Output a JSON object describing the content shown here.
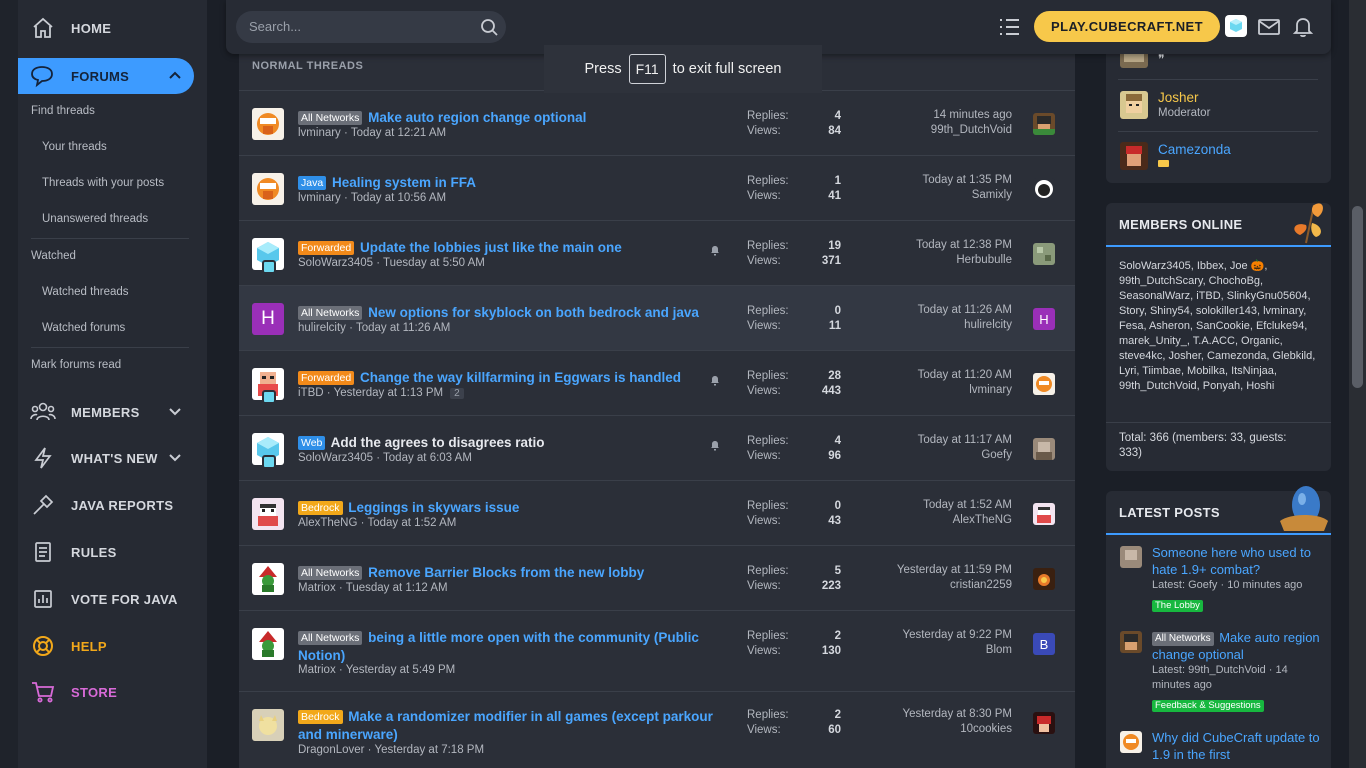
{
  "sidebar": {
    "home": "HOME",
    "forums": "FORUMS",
    "sub": {
      "find_threads": "Find threads",
      "your_threads": "Your threads",
      "threads_with_posts": "Threads with your posts",
      "unanswered": "Unanswered threads",
      "watched": "Watched",
      "watched_threads": "Watched threads",
      "watched_forums": "Watched forums",
      "mark_read": "Mark forums read"
    },
    "members": "MEMBERS",
    "whats_new": "WHAT'S NEW",
    "java_reports": "JAVA REPORTS",
    "rules": "RULES",
    "vote": "VOTE FOR JAVA",
    "help": "HELP",
    "store": "STORE"
  },
  "topbar": {
    "search_placeholder": "Search...",
    "play_label": "PLAY.CUBECRAFT.NET"
  },
  "toast": {
    "before": "Press",
    "key": "F11",
    "after": "to exit full screen"
  },
  "section_title": "NORMAL THREADS",
  "stats_labels": {
    "replies": "Replies:",
    "views": "Views:"
  },
  "threads": [
    {
      "prefix": "All Networks",
      "title": "Make auto region change optional",
      "author": "lvminary",
      "date": "Today at 12:21 AM",
      "replies": "4",
      "views": "84",
      "last_date": "14 minutes ago",
      "last_user": "99th_DutchVoid"
    },
    {
      "prefix": "Java",
      "title": "Healing system in FFA",
      "author": "lvminary",
      "date": "Today at 10:56 AM",
      "replies": "1",
      "views": "41",
      "last_date": "Today at 1:35 PM",
      "last_user": "Samixly"
    },
    {
      "prefix": "Forwarded",
      "title": "Update the lobbies just like the main one",
      "author": "SoloWarz3405",
      "date": "Tuesday at 5:50 AM",
      "replies": "19",
      "views": "371",
      "last_date": "Today at 12:38 PM",
      "last_user": "Herbubulle"
    },
    {
      "prefix": "All Networks",
      "title": "New options for skyblock on both bedrock and java",
      "author": "hulirelcity",
      "date": "Today at 11:26 AM",
      "replies": "0",
      "views": "11",
      "last_date": "Today at 11:26 AM",
      "last_user": "hulirelcity",
      "avatar_letter": "H"
    },
    {
      "prefix": "Forwarded",
      "title": "Change the way killfarming in Eggwars is handled",
      "author": "iTBD",
      "date": "Yesterday at 1:13 PM",
      "pages": "2",
      "replies": "28",
      "views": "443",
      "last_date": "Today at 11:20 AM",
      "last_user": "lvminary"
    },
    {
      "prefix": "Web",
      "title": "Add the agrees to disagrees ratio",
      "author": "SoloWarz3405",
      "date": "Today at 6:03 AM",
      "replies": "4",
      "views": "96",
      "last_date": "Today at 11:17 AM",
      "last_user": "Goefy"
    },
    {
      "prefix": "Bedrock",
      "title": "Leggings in skywars issue",
      "author": "AlexTheNG",
      "date": "Today at 1:52 AM",
      "replies": "0",
      "views": "43",
      "last_date": "Today at 1:52 AM",
      "last_user": "AlexTheNG"
    },
    {
      "prefix": "All Networks",
      "title": "Remove Barrier Blocks from the new lobby",
      "author": "Matriox",
      "date": "Tuesday at 1:12 AM",
      "replies": "5",
      "views": "223",
      "last_date": "Yesterday at 11:59 PM",
      "last_user": "cristian2259"
    },
    {
      "prefix": "All Networks",
      "title": "being a little more open with the community (Public Notion)",
      "author": "Matriox",
      "date": "Yesterday at 5:49 PM",
      "replies": "2",
      "views": "130",
      "last_date": "Yesterday at 9:22 PM",
      "last_user": "Blom",
      "last_letter": "B"
    },
    {
      "prefix": "Bedrock",
      "title": "Make a randomizer modifier in all games (except parkour and minerware)",
      "author": "DragonLover",
      "date": "Yesterday at 7:18 PM",
      "replies": "2",
      "views": "60",
      "last_date": "Yesterday at 8:30 PM",
      "last_user": "10cookies"
    }
  ],
  "staff": [
    {
      "name": "Josher",
      "role": "Moderator",
      "color": "#f7c84a"
    },
    {
      "name": "Camezonda",
      "role": "",
      "color": "#4aa6ff"
    }
  ],
  "staff_top_text": "❞",
  "online": {
    "title": "MEMBERS ONLINE",
    "list": "SoloWarz3405, Ibbex, Joe 🎃, 99th_DutchScary, ChochoBg, SeasonalWarz, iTBD, SlinkyGnu05604, Story, Shiny54, solokiller143, lvminary, Fesa, Asheron, SanCookie, Efcluke94, marek_Unity_, T.A.ACC, Organic, steve4kc, Josher, Camezonda, Glebkild, Lyri, Tiimbae, Mobilka, ItsNinjaa, 99th_DutchVoid, Ponyah, Hoshi",
    "total": "Total: 366 (members: 33, guests: 333)"
  },
  "latest": {
    "title": "LATEST POSTS",
    "posts": [
      {
        "prefix": "",
        "title": "Someone here who used to hate 1.9+ combat?",
        "meta": "Latest: Goefy · 10 minutes ago",
        "node": "The Lobby"
      },
      {
        "prefix": "All Networks",
        "title": "Make auto region change optional",
        "meta": "Latest: 99th_DutchVoid · 14 minutes ago",
        "node": "Feedback & Suggestions"
      },
      {
        "prefix": "",
        "title": "Why did CubeCraft update to 1.9 in the first",
        "meta": "",
        "node": ""
      }
    ]
  },
  "colors": {
    "accent": "#3d9bff",
    "play": "#f7c84a",
    "prefix_all": "#6b6f78",
    "prefix_java": "#2f8fe8",
    "prefix_forwarded": "#f28a1a",
    "prefix_web": "#2f8fe8",
    "prefix_bedrock": "#f2a81a",
    "help": "#f2a81a",
    "store": "#d86ad8"
  }
}
